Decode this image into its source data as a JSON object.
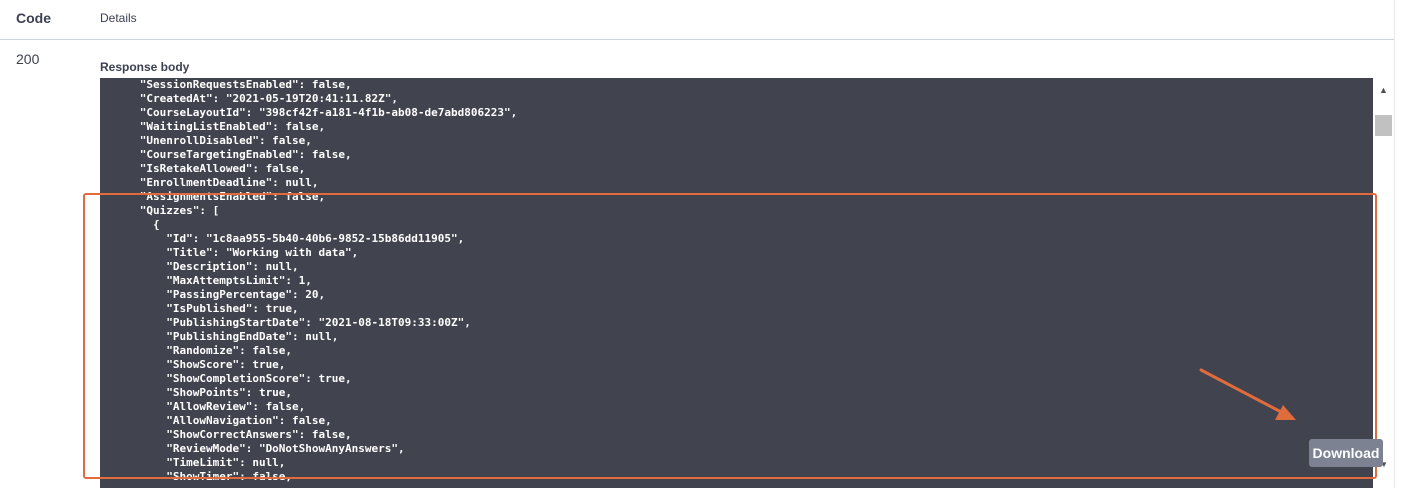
{
  "table": {
    "header_code": "Code",
    "header_details": "Details",
    "status_code": "200",
    "response_body_label": "Response body"
  },
  "response_body": {
    "lines": [
      "      \"SessionRequestsEnabled\": false,",
      "      \"CreatedAt\": \"2021-05-19T20:41:11.82Z\",",
      "      \"CourseLayoutId\": \"398cf42f-a181-4f1b-ab08-de7abd806223\",",
      "      \"WaitingListEnabled\": false,",
      "      \"UnenrollDisabled\": false,",
      "      \"CourseTargetingEnabled\": false,",
      "      \"IsRetakeAllowed\": false,",
      "      \"EnrollmentDeadline\": null,",
      "      \"AssignmentsEnabled\": false,",
      "      \"Quizzes\": [",
      "        {",
      "          \"Id\": \"1c8aa955-5b40-40b6-9852-15b86dd11905\",",
      "          \"Title\": \"Working with data\",",
      "          \"Description\": null,",
      "          \"MaxAttemptsLimit\": 1,",
      "          \"PassingPercentage\": 20,",
      "          \"IsPublished\": true,",
      "          \"PublishingStartDate\": \"2021-08-18T09:33:00Z\",",
      "          \"PublishingEndDate\": null,",
      "          \"Randomize\": false,",
      "          \"ShowScore\": true,",
      "          \"ShowCompletionScore\": true,",
      "          \"ShowPoints\": true,",
      "          \"AllowReview\": false,",
      "          \"AllowNavigation\": false,",
      "          \"ShowCorrectAnswers\": false,",
      "          \"ReviewMode\": \"DoNotShowAnyAnswers\",",
      "          \"TimeLimit\": null,",
      "          \"ShowTimer\": false,"
    ]
  },
  "download_button": {
    "label": "Download"
  },
  "scrollbar": {
    "up_icon": "▲",
    "down_icon": "▼"
  },
  "colors": {
    "code_background": "#41444e",
    "annotation": "#e06b3c",
    "download_button": "#7d8293"
  }
}
